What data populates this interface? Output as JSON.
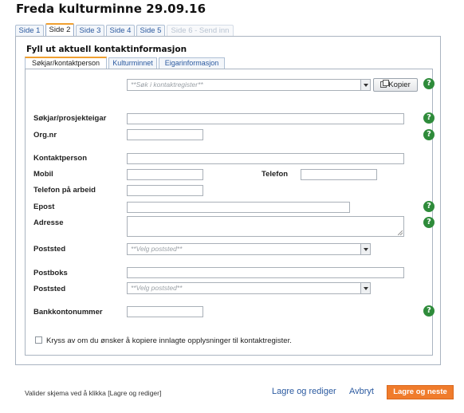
{
  "page": {
    "title": "Freda kulturminne 29.09.16"
  },
  "top_tabs": [
    {
      "label": "Side 1"
    },
    {
      "label": "Side 2"
    },
    {
      "label": "Side 3"
    },
    {
      "label": "Side 4"
    },
    {
      "label": "Side 5"
    },
    {
      "label": "Side 6 - Send inn"
    }
  ],
  "section": {
    "title": "Fyll ut aktuell kontaktinformasjon"
  },
  "sub_tabs": [
    {
      "label": "Søkjar/kontaktperson"
    },
    {
      "label": "Kulturminnet"
    },
    {
      "label": "Eigarinformasjon"
    }
  ],
  "form": {
    "search_placeholder": "**Søk i kontaktregister**",
    "copy_label": "Kopier",
    "sokjar_label": "Søkjar/prosjekteigar",
    "orgnr_label": "Org.nr",
    "kontaktperson_label": "Kontaktperson",
    "mobil_label": "Mobil",
    "telefon_label": "Telefon",
    "telefon_arbeid_label": "Telefon på arbeid",
    "epost_label": "Epost",
    "adresse_label": "Adresse",
    "poststed_label": "Poststed",
    "poststed_placeholder": "**Velg poststed**",
    "postboks_label": "Postboks",
    "poststed2_label": "Poststed",
    "poststed2_placeholder": "**Velg poststed**",
    "bankkonto_label": "Bankkontonummer",
    "copy_checkbox_label": "Kryss av om du ønsker å kopiere innlagte opplysninger til kontaktregister."
  },
  "footer": {
    "note": "Valider skjema ved å klikka [Lagre og rediger]",
    "save_edit": "Lagre og rediger",
    "cancel": "Avbryt",
    "save_next": "Lagre og neste"
  },
  "help_glyph": "?",
  "colors": {
    "accent": "#f07c2c",
    "help": "#2e8b3a",
    "link": "#2b5aa0"
  }
}
